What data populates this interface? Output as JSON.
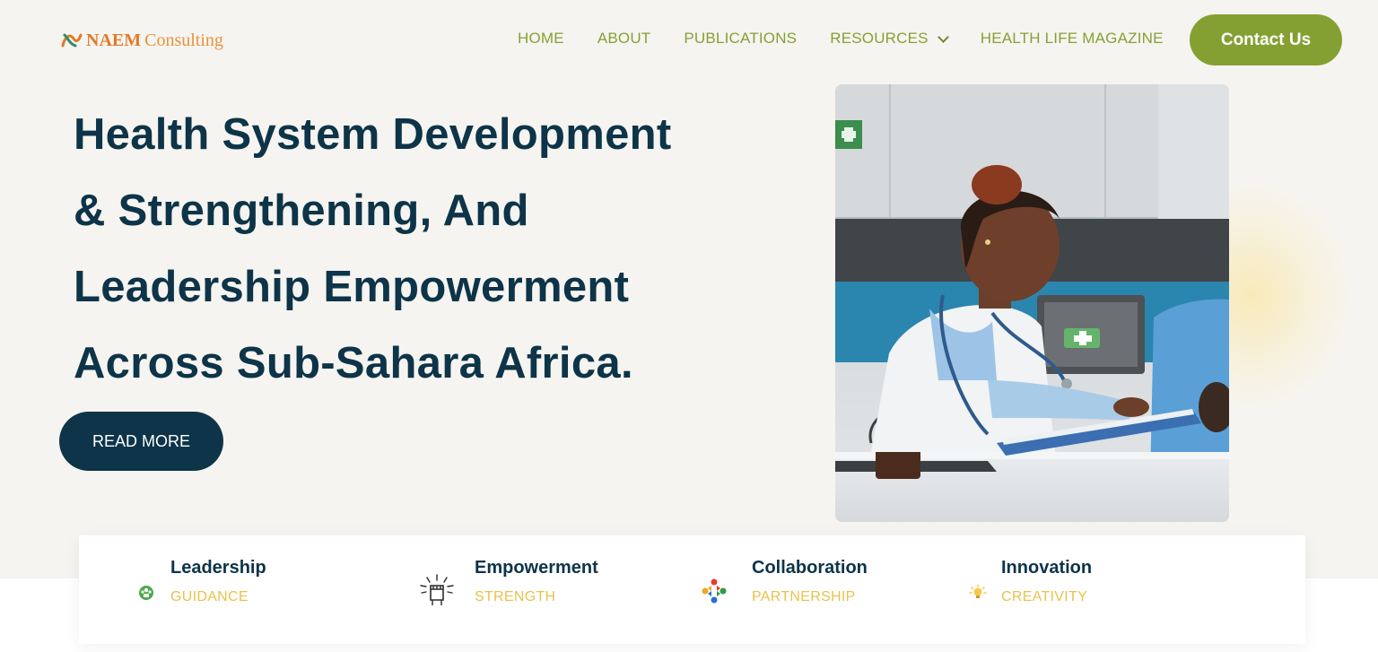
{
  "header": {
    "logo": {
      "brand": "NAEM",
      "suffix": "Consulting"
    },
    "nav": [
      {
        "label": "HOME"
      },
      {
        "label": "ABOUT"
      },
      {
        "label": "PUBLICATIONS"
      },
      {
        "label": "RESOURCES",
        "icon": "chevron-down-icon"
      },
      {
        "label": "HEALTH LIFE MAGAZINE"
      }
    ],
    "contact_label": "Contact Us"
  },
  "hero": {
    "title_lines": [
      "Health System Development",
      "& Strengthening, And",
      "Leadership Empowerment",
      "Across Sub-Sahara Africa."
    ],
    "read_more_label": "READ MORE"
  },
  "features": [
    {
      "title": "Leadership",
      "subtitle": "GUIDANCE",
      "icon": "leadership-icon"
    },
    {
      "title": "Empowerment",
      "subtitle": "STRENGTH",
      "icon": "raised-fist-icon"
    },
    {
      "title": "Collaboration",
      "subtitle": "PARTNERSHIP",
      "icon": "collaboration-icon"
    },
    {
      "title": "Innovation",
      "subtitle": "CREATIVITY",
      "icon": "lightbulb-icon"
    }
  ],
  "colors": {
    "background": "#f6f4f0",
    "navy": "#0d3448",
    "olive": "#85a032",
    "nav_text": "#84a136",
    "accent_yellow": "#e9c24a",
    "logo_orange": "#e27a26"
  }
}
